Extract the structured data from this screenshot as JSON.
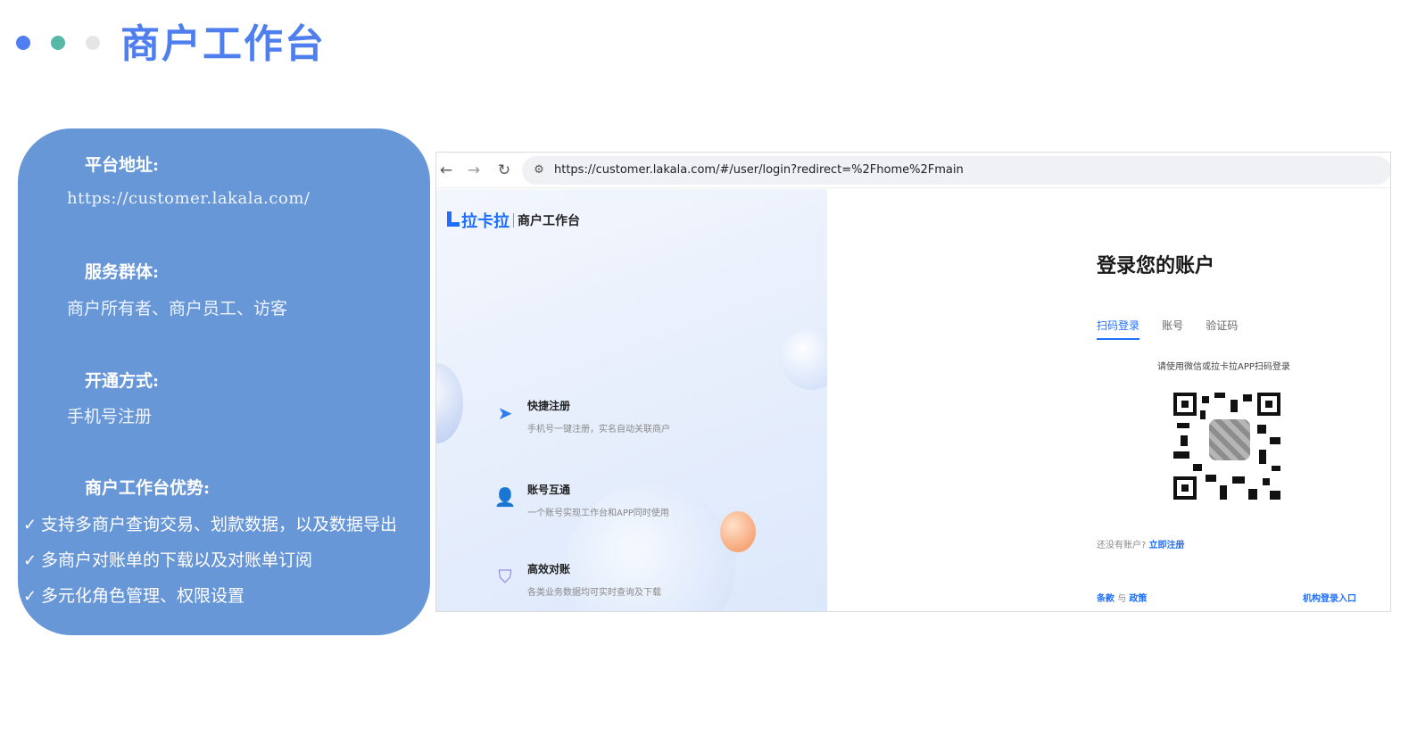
{
  "slide": {
    "title": "商户工作台",
    "dot_colors": [
      "#4f7fef",
      "#56b8a6",
      "#e6e6e6"
    ]
  },
  "info_panel": {
    "bg_color": "#6897d8",
    "platform_label": "平台地址:",
    "platform_url": "https://customer.lakala.com/",
    "audience_label": "服务群体:",
    "audience_value": "商户所有者、商户员工、访客",
    "activation_label": "开通方式:",
    "activation_value": "手机号注册",
    "advantages_label": "商户工作台优势:",
    "advantages": [
      "支持多商户查询交易、划款数据，以及数据导出",
      "多商户对账单的下载以及对账单订阅",
      "多元化角色管理、权限设置"
    ],
    "check_icon": "✓"
  },
  "browser": {
    "back_icon": "←",
    "forward_icon": "→",
    "reload_icon": "↻",
    "site_icon": "⚙",
    "url": "https://customer.lakala.com/#/user/login?redirect=%2Fhome%2Fmain"
  },
  "brand": {
    "name": "拉卡拉",
    "subtitle": "商户工作台",
    "color": "#1f6fff"
  },
  "features": [
    {
      "icon": "paper-plane-icon",
      "glyph": "➤",
      "title": "快捷注册",
      "desc": "手机号一键注册，实名自动关联商户"
    },
    {
      "icon": "user-icon",
      "glyph": "👤",
      "title": "账号互通",
      "desc": "一个账号实现工作台和APP同时使用"
    },
    {
      "icon": "shield-check-icon",
      "glyph": "⛉",
      "title": "高效对账",
      "desc": "各类业务数据均可实时查询及下载"
    }
  ],
  "login": {
    "heading": "登录您的账户",
    "tabs": [
      {
        "label": "扫码登录",
        "active": true
      },
      {
        "label": "账号",
        "active": false
      },
      {
        "label": "验证码",
        "active": false
      }
    ],
    "qr_hint": "请使用微信或拉卡拉APP扫码登录",
    "no_account": "还没有账户?",
    "register_link": "立即注册",
    "terms_link": "条款",
    "and_text": "与",
    "policy_link": "政策",
    "org_login_link": "机构登录入口"
  }
}
